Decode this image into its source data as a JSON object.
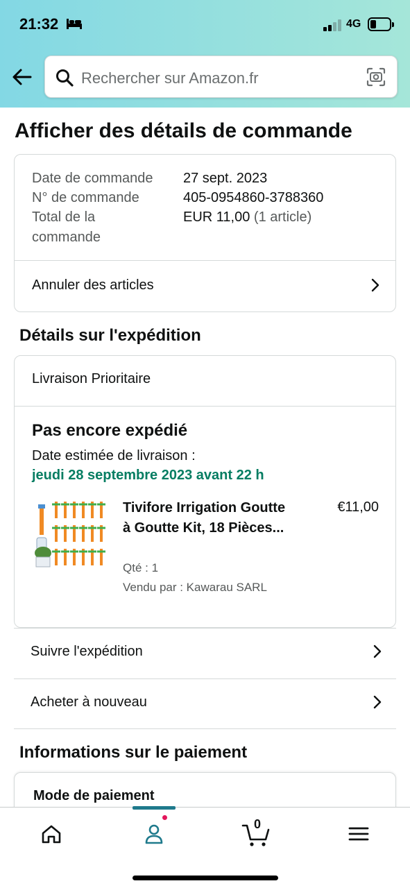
{
  "status_bar": {
    "time": "21:32",
    "network": "4G"
  },
  "search": {
    "placeholder": "Rechercher sur Amazon.fr"
  },
  "page_title": "Afficher des détails de commande",
  "order_summary": {
    "date_label": "Date de commande",
    "date_value": "27 sept. 2023",
    "number_label": "N° de commande",
    "number_value": "405-0954860-3788360",
    "total_label_line1": "Total de la",
    "total_label_line2": "commande",
    "total_value": "EUR 11,00",
    "total_count": "(1 article)",
    "cancel_label": "Annuler des articles"
  },
  "shipping": {
    "section_title": "Détails sur l'expédition",
    "method": "Livraison Prioritaire",
    "status": "Pas encore expédié",
    "estimate_label": "Date estimée de livraison :",
    "estimate_date": "jeudi 28 septembre 2023 avant 22 h",
    "product": {
      "title": "Tivifore Irrigation Goutte à Goutte Kit, 18 Pièces...",
      "price": "€11,00",
      "quantity": "Qté : 1",
      "seller": "Vendu par : Kawarau SARL"
    },
    "track_label": "Suivre l'expédition",
    "buy_again_label": "Acheter à nouveau"
  },
  "payment": {
    "section_title": "Informations sur le paiement",
    "method_label": "Mode de paiement"
  },
  "bottom_nav": {
    "cart_count": "0"
  },
  "colors": {
    "accent": "#1f7a8c",
    "delivery_green": "#067d62",
    "badge": "#e3165b"
  }
}
